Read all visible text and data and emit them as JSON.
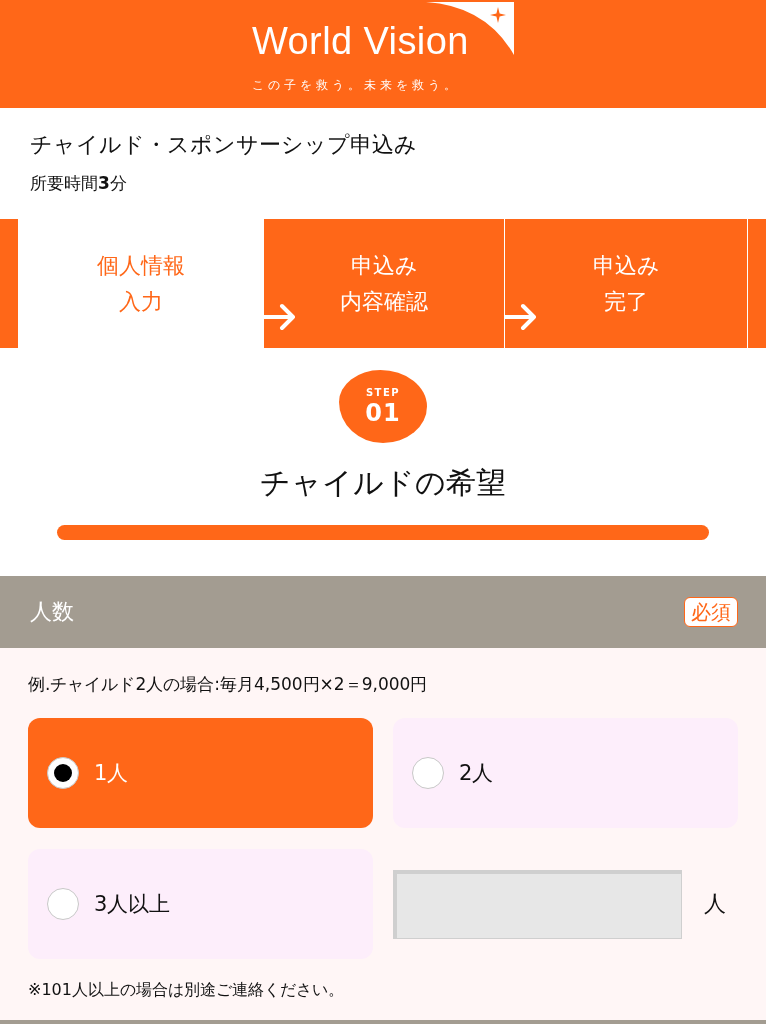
{
  "header": {
    "logo": {
      "name": "World Vision",
      "tagline": "この子を救う。未来を救う。"
    }
  },
  "form": {
    "title": "チャイルド・スポンサーシップ申込み",
    "duration": "所要時間**3**分"
  },
  "steps": [
    {
      "lines": [
        "個人情報",
        "入力"
      ],
      "selected": true
    },
    {
      "lines": [
        "申込み",
        "内容確認"
      ],
      "selected": false
    },
    {
      "lines": [
        "申込み",
        "完了"
      ],
      "selected": false
    }
  ],
  "step_badge": {
    "label": "STEP",
    "number": "01"
  },
  "section_heading": "チャイルドの希望",
  "fields": [
    {
      "label": "人数",
      "badge": "必須",
      "example": "例.チャイルド2人の場合:毎月4,500円×2＝9,000円",
      "options": [
        {
          "label": "1人",
          "selected": true
        },
        {
          "label": "2人",
          "selected": false
        },
        {
          "label": "3人以上",
          "selected": false
        }
      ],
      "count_input": {
        "unit": "人"
      },
      "note": "※101人以上の場合は別途ご連絡ください。"
    }
  ]
}
